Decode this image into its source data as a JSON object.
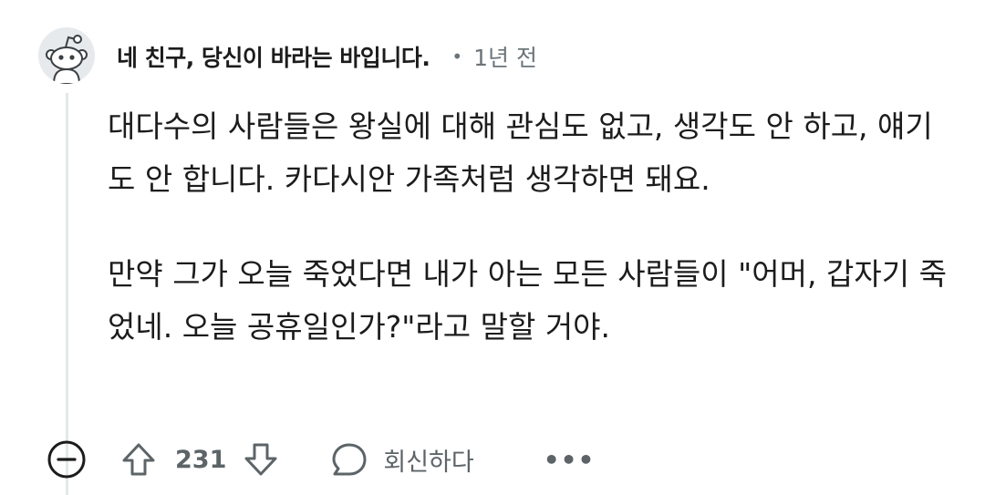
{
  "comment": {
    "username": "네 친구, 당신이 바라는 바입니다.",
    "separator": "•",
    "time_ago": "1년 전",
    "paragraphs": [
      "대다수의 사람들은 왕실에 대해 관심도 없고, 생각도 안 하고, 얘기도 안 합니다. 카다시안 가족처럼 생각하면 돼요.",
      "만약 그가 오늘 죽었다면 내가 아는 모든 사람들이 \"어머, 갑자기 죽었네. 오늘 공휴일인가?\"라고 말할 거야."
    ]
  },
  "actions": {
    "collapse_icon": "minus-circle-icon",
    "upvote_icon": "arrow-up-icon",
    "score": "231",
    "downvote_icon": "arrow-down-icon",
    "reply_icon": "speech-bubble-icon",
    "reply_label": "회신하다",
    "more_label": "•••"
  },
  "colors": {
    "text": "#1c1c1c",
    "meta": "#6b7479",
    "icon": "#5d6468",
    "thread_line": "#e5e8ea"
  }
}
